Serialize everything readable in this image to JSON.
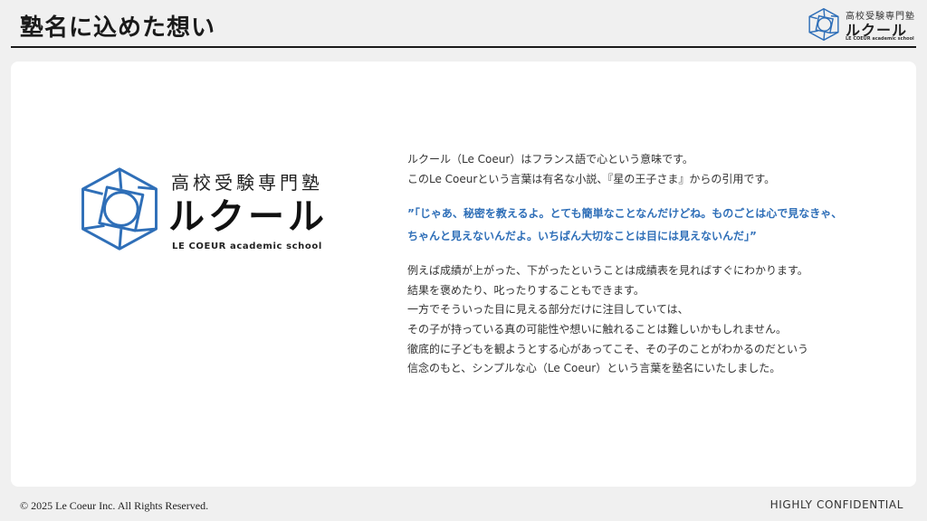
{
  "header": {
    "title": "塾名に込めた想い",
    "logo": {
      "jp": "高校受験専門塾",
      "kana": "ルクール",
      "en": "LE COEUR academic school"
    }
  },
  "brand": {
    "jp": "高校受験専門塾",
    "kana": "ルクール",
    "en": "LE COEUR  academic school",
    "accent_color": "#2f6fb8",
    "icon": "cube-heart-icon"
  },
  "body": {
    "intro": [
      "ルクール（Le Coeur）はフランス語で心という意味です。",
      "このLe Coeurという言葉は有名な小説、『星の王子さま』からの引用です。"
    ],
    "quote": [
      "”「じゃあ、秘密を教えるよ。とても簡単なことなんだけどね。ものごとは心で見なきゃ、",
      "ちゃんと見えないんだよ。いちばん大切なことは目には見えないんだ」”"
    ],
    "paragraph": [
      "例えば成績が上がった、下がったということは成績表を見ればすぐにわかります。",
      "結果を褒めたり、叱ったりすることもできます。",
      "一方でそういった目に見える部分だけに注目していては、",
      "その子が持っている真の可能性や想いに触れることは難しいかもしれません。",
      "徹底的に子どもを観ようとする心があってこそ、その子のことがわかるのだという",
      "信念のもと、シンプルな心（Le Coeur）という言葉を塾名にいたしました。"
    ]
  },
  "footer": {
    "copyright": "© 2025 Le Coeur Inc. All Rights Reserved.",
    "confidential": "HIGHLY CONFIDENTIAL"
  }
}
